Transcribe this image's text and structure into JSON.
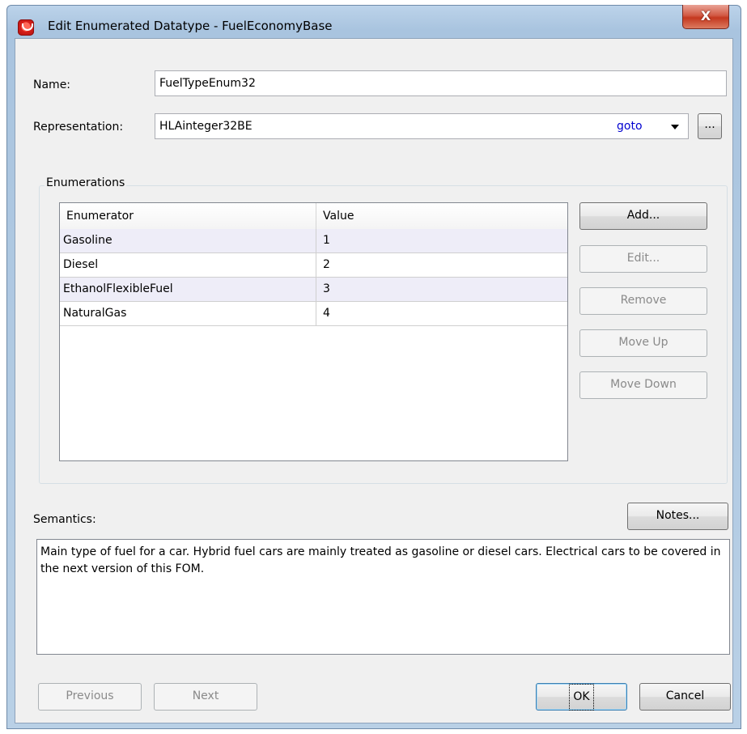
{
  "window": {
    "title": "Edit Enumerated Datatype - FuelEconomyBase",
    "close_label": "X"
  },
  "form": {
    "name_label": "Name:",
    "name_value": "FuelTypeEnum32",
    "representation_label": "Representation:",
    "representation_value": "HLAinteger32BE",
    "goto_label": "goto",
    "browse_label": "..."
  },
  "enumerations": {
    "group_title": "Enumerations",
    "columns": [
      "Enumerator",
      "Value"
    ],
    "rows": [
      {
        "enumerator": "Gasoline",
        "value": "1"
      },
      {
        "enumerator": "Diesel",
        "value": "2"
      },
      {
        "enumerator": "EthanolFlexibleFuel",
        "value": "3"
      },
      {
        "enumerator": "NaturalGas",
        "value": "4"
      }
    ],
    "buttons": {
      "add": "Add...",
      "edit": "Edit...",
      "remove": "Remove",
      "move_up": "Move Up",
      "move_down": "Move Down"
    }
  },
  "semantics": {
    "label": "Semantics:",
    "notes_button": "Notes...",
    "text": "Main type of fuel for a car. Hybrid fuel cars are mainly treated as gasoline or diesel cars. Electrical cars to be covered in the next version of this FOM."
  },
  "footer": {
    "previous": "Previous",
    "next": "Next",
    "ok": "OK",
    "cancel": "Cancel"
  },
  "colors": {
    "link": "#0000d0",
    "close_button": "#c4381f",
    "alt_row": "#eeedf8"
  }
}
